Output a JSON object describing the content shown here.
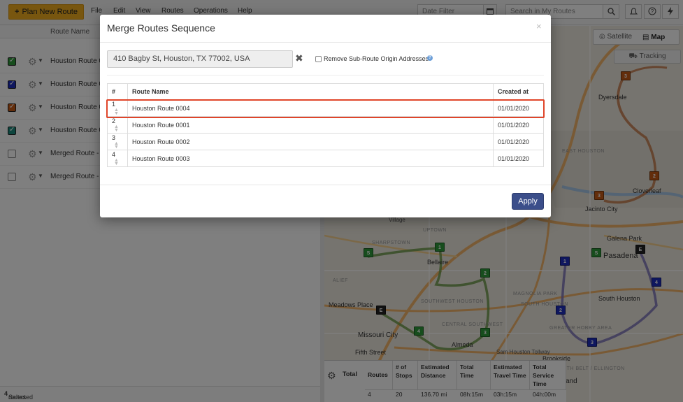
{
  "toolbar": {
    "plan_new_route": "Plan New Route",
    "menus": [
      "File",
      "Edit",
      "View",
      "Routes",
      "Operations",
      "Help"
    ],
    "date_filter_placeholder": "Date Filter",
    "search_placeholder": "Search in My Routes"
  },
  "route_list": {
    "header": "Route Name",
    "rows": [
      {
        "name": "Houston Route 00",
        "checked": true,
        "color": "#2e9b3a"
      },
      {
        "name": "Houston Route 00",
        "checked": true,
        "color": "#1f2fbf"
      },
      {
        "name": "Houston Route 00",
        "checked": true,
        "color": "#c75a16"
      },
      {
        "name": "Houston Route 00",
        "checked": true,
        "color": "#1a8a7c"
      },
      {
        "name": "Merged Route - S",
        "checked": false,
        "color": "#ffffff"
      },
      {
        "name": "Merged Route - S",
        "checked": false,
        "color": "#ffffff"
      }
    ],
    "status_prefix": "Selected",
    "status_count": "4",
    "status_suffix": "routes"
  },
  "map": {
    "satellite": "Satellite",
    "map": "Map",
    "tracking": "Tracking",
    "labels": [
      "Dyersdale",
      "EAST HOUSTON",
      "Cloverleaf",
      "Jacinto City",
      "Galena Park",
      "Pasadena",
      "South Houston",
      "Bellaire",
      "Meadows Place",
      "Missouri City",
      "Fifth Street",
      "Almeda",
      "Brookside",
      "UPTOWN",
      "SHARPSTOWN",
      "ALIEF",
      "SOUTHWEST HOUSTON",
      "CENTRAL SOUTHWEST",
      "SOUTH BELT / ELLINGTON",
      "GREATER HOBBY AREA",
      "MAGNOLIA PARK",
      "SOUTH HOUSTON",
      "Village",
      "Sam Houston Tollway",
      "and"
    ],
    "markers": [
      {
        "label": "3",
        "color": "#c75a16"
      },
      {
        "label": "2",
        "color": "#c75a16"
      },
      {
        "label": "3",
        "color": "#c75a16"
      },
      {
        "label": "1",
        "color": "#2e9b3a"
      },
      {
        "label": "S",
        "color": "#2e9b3a"
      },
      {
        "label": "2",
        "color": "#2e9b3a"
      },
      {
        "label": "4",
        "color": "#2e9b3a"
      },
      {
        "label": "3",
        "color": "#2e9b3a"
      },
      {
        "label": "S",
        "color": "#2e9b3a"
      },
      {
        "label": "E",
        "color": "#222222"
      },
      {
        "label": "E",
        "color": "#222222"
      },
      {
        "label": "1",
        "color": "#1f2fbf"
      },
      {
        "label": "4",
        "color": "#1f2fbf"
      },
      {
        "label": "2",
        "color": "#1f2fbf"
      },
      {
        "label": "3",
        "color": "#1f2fbf"
      }
    ]
  },
  "summary": {
    "total_label": "Total",
    "headers": [
      "Routes",
      "# of Stops",
      "Estimated Distance",
      "Total Time",
      "Estimated Travel Time",
      "Total Service Time"
    ],
    "values": [
      "4",
      "20",
      "136.70 mi",
      "08h:15m",
      "03h:15m",
      "04h:00m"
    ]
  },
  "modal": {
    "title": "Merge Routes Sequence",
    "close": "×",
    "address": "410 Bagby St, Houston, TX 77002, USA",
    "remove_sub_route_label": "Remove Sub-Route Origin Addresses",
    "table": {
      "headers": [
        "#",
        "Route Name",
        "Created at"
      ],
      "rows": [
        {
          "num": "1",
          "name": "Houston Route 0004",
          "created": "01/01/2020"
        },
        {
          "num": "2",
          "name": "Houston Route 0001",
          "created": "01/01/2020"
        },
        {
          "num": "3",
          "name": "Houston Route 0002",
          "created": "01/01/2020"
        },
        {
          "num": "4",
          "name": "Houston Route 0003",
          "created": "01/01/2020"
        }
      ]
    },
    "apply": "Apply"
  },
  "colors": {
    "plan_button": "#f0ad1f",
    "apply_button": "#3b4e8a",
    "highlight": "#e0452a"
  }
}
